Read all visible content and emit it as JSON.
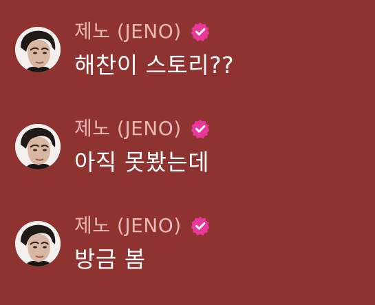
{
  "colors": {
    "background": "#8f3331",
    "sender_name": "#e8b9b6",
    "message_text": "#ffffff",
    "verified_badge": "#e8389a"
  },
  "messages": [
    {
      "sender": "제노 (JENO)",
      "verified_icon": "verified-badge-icon",
      "avatar_icon": "avatar",
      "text": "해찬이 스토리??"
    },
    {
      "sender": "제노 (JENO)",
      "verified_icon": "verified-badge-icon",
      "avatar_icon": "avatar",
      "text": "아직 못봤는데"
    },
    {
      "sender": "제노 (JENO)",
      "verified_icon": "verified-badge-icon",
      "avatar_icon": "avatar",
      "text": "방금 봄"
    }
  ]
}
